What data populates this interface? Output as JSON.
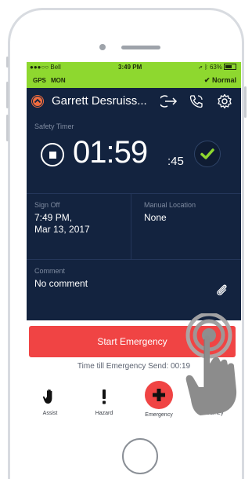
{
  "status_bar": {
    "carrier": "●●●○○ Bell",
    "time": "3:49 PM",
    "battery": "63%"
  },
  "info_bar": {
    "gps": "GPS",
    "mon": "MON",
    "mode": "Normal"
  },
  "header": {
    "name": "Garrett Desruiss..."
  },
  "timer": {
    "label": "Safety Timer",
    "main": "01:59",
    "seconds": ":45"
  },
  "sign_off": {
    "label": "Sign Off",
    "line1": "7:49 PM,",
    "line2": "Mar 13, 2017"
  },
  "manual_location": {
    "label": "Manual Location",
    "value": "None"
  },
  "comment": {
    "label": "Comment",
    "value": "No comment"
  },
  "emergency": {
    "button_label": "Start Emergency",
    "countdown": "Time till Emergency Send: 00:19"
  },
  "tabs": [
    {
      "label": "Assist",
      "icon": "hand-icon"
    },
    {
      "label": "Hazard",
      "icon": "exclamation-icon"
    },
    {
      "label": "Emergency",
      "icon": "plus-icon"
    },
    {
      "label": "Journey",
      "icon": "journey-icon"
    }
  ],
  "colors": {
    "accent_green": "#8ed82f",
    "navy": "#13233f",
    "emergency_red": "#f04444",
    "chevron_orange": "#f06c3f"
  }
}
